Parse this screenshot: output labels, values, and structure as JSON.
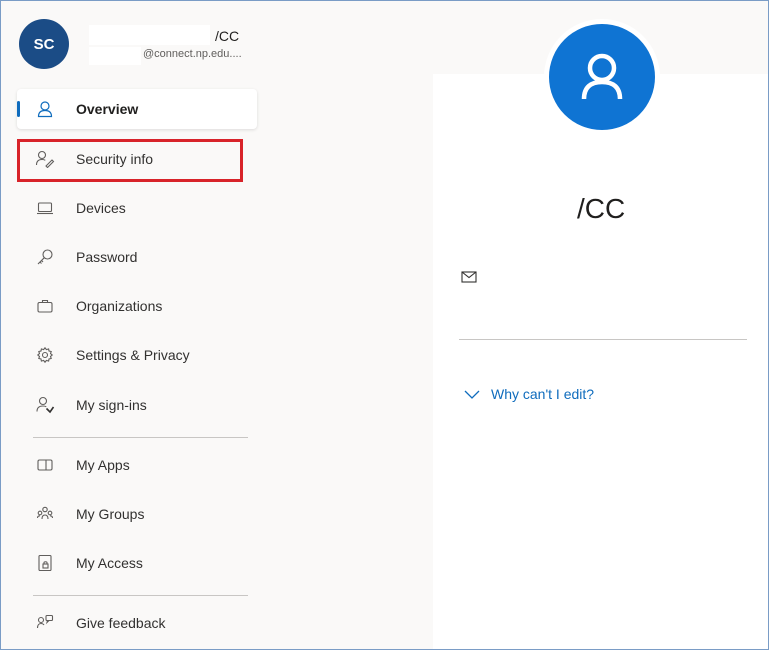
{
  "account": {
    "initials": "SC",
    "name_suffix": "/CC",
    "email_suffix": "@connect.np.edu...."
  },
  "nav": {
    "overview": "Overview",
    "security_info": "Security info",
    "devices": "Devices",
    "password": "Password",
    "organizations": "Organizations",
    "settings_privacy": "Settings & Privacy",
    "my_signins": "My sign-ins",
    "my_apps": "My Apps",
    "my_groups": "My Groups",
    "my_access": "My Access",
    "give_feedback": "Give feedback"
  },
  "profile": {
    "name": "/CC",
    "why_cant_edit": "Why can't I edit?"
  },
  "colors": {
    "accent": "#0f6cbd",
    "avatar_small": "#1b4c86",
    "avatar_large": "#0f74d3",
    "highlight_box": "#d8232a"
  },
  "icons": {
    "overview": "user-outline-icon",
    "security_info": "user-key-icon",
    "devices": "laptop-icon",
    "password": "key-icon",
    "organizations": "briefcase-icon",
    "settings_privacy": "gear-icon",
    "my_signins": "user-signin-icon",
    "my_apps": "apps-panel-icon",
    "my_groups": "people-group-icon",
    "my_access": "lock-document-icon",
    "give_feedback": "feedback-icon",
    "mail": "mail-icon",
    "chevron": "chevron-down-icon"
  }
}
